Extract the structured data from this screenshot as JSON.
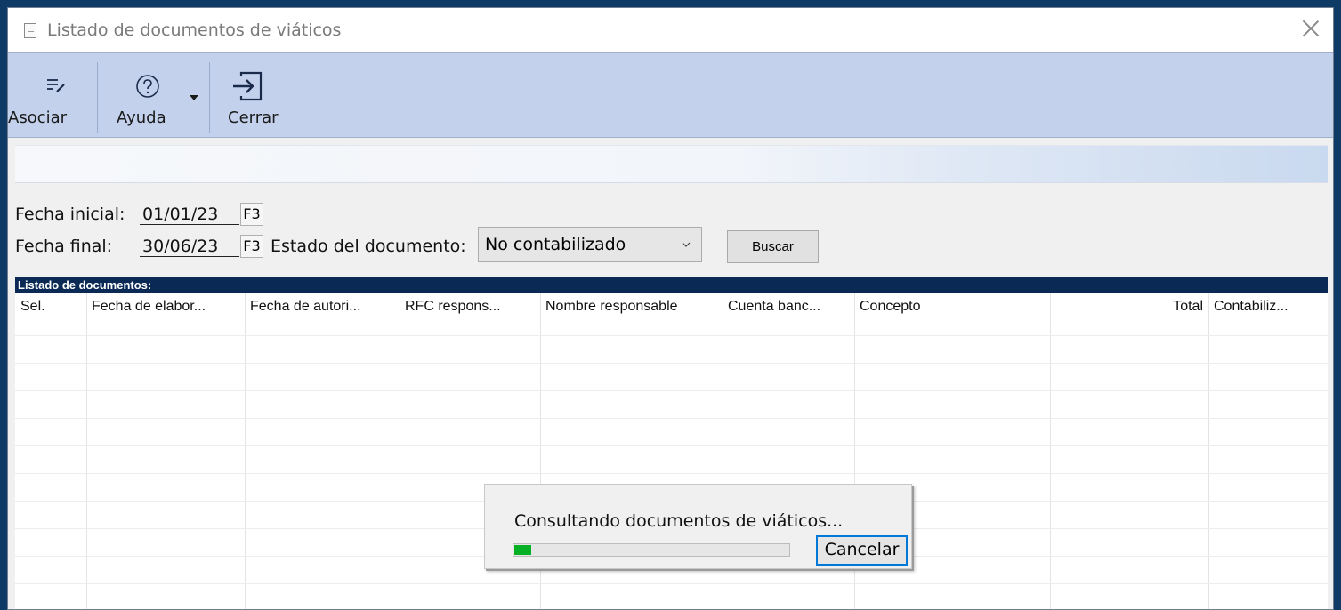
{
  "window": {
    "title": "Listado de documentos de viáticos"
  },
  "toolbar": {
    "asociar_label": "Asociar",
    "ayuda_label": "Ayuda",
    "cerrar_label": "Cerrar",
    "bg_color": "#c3d1ec"
  },
  "filters": {
    "fecha_inicial_label": "Fecha inicial:",
    "fecha_inicial_value": "01/01/23",
    "fecha_final_label": "Fecha final:",
    "fecha_final_value": "30/06/23",
    "f3_label": "F3",
    "estado_label": "Estado del documento:",
    "estado_value": "No contabilizado",
    "buscar_label": "Buscar"
  },
  "grid": {
    "title": "Listado de documentos:",
    "title_bg": "#0a2a55",
    "columns": [
      "Sel.",
      "Fecha de elabor...",
      "Fecha de autori...",
      "RFC respons...",
      "Nombre responsable",
      "Cuenta banc...",
      "Concepto",
      "Total",
      "Contabiliz..."
    ]
  },
  "progress_dialog": {
    "message": "Consultando documentos de viáticos...",
    "progress": 0.06,
    "progress_color": "#06b025",
    "cancel_label": "Cancelar"
  }
}
